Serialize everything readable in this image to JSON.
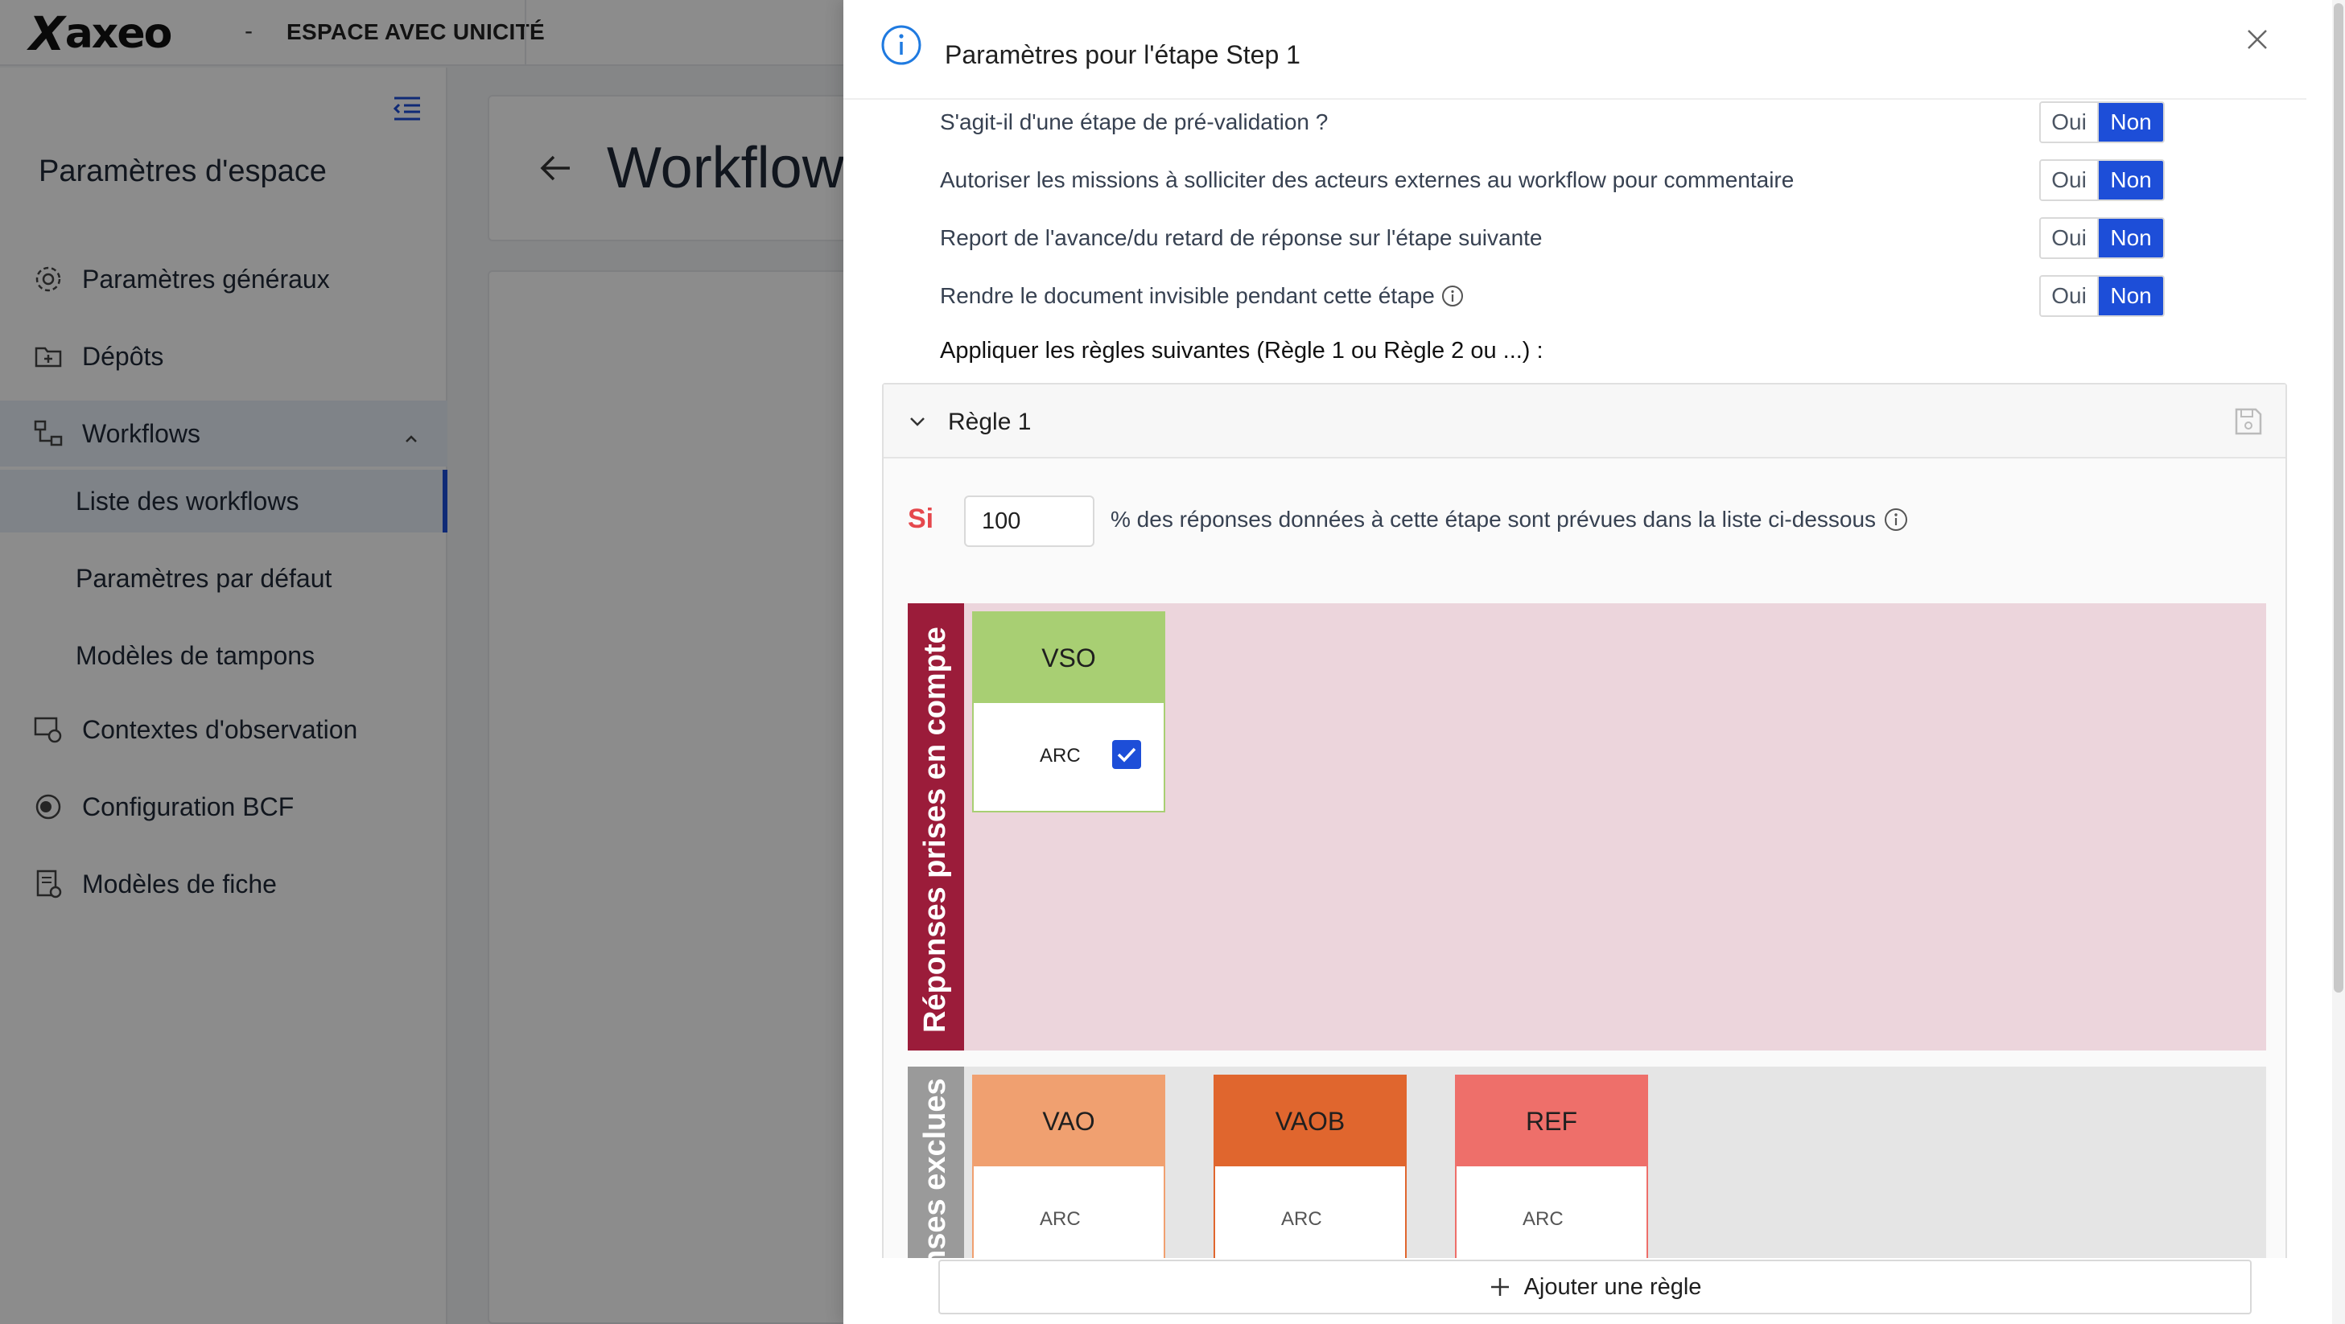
{
  "app": {
    "logo_text": "axeo",
    "logo_x": "X",
    "logo_dash": "-",
    "workspace": "ESPACE AVEC UNICITÉ"
  },
  "sidebar": {
    "title": "Paramètres d'espace",
    "items": [
      {
        "label": "Paramètres généraux",
        "icon": "gear-icon"
      },
      {
        "label": "Dépôts",
        "icon": "folder-icon"
      },
      {
        "label": "Workflows",
        "icon": "workflow-icon"
      },
      {
        "label": "Contextes d'observation",
        "icon": "observation-icon"
      },
      {
        "label": "Configuration BCF",
        "icon": "bcf-icon"
      },
      {
        "label": "Modèles de fiche",
        "icon": "form-icon"
      }
    ],
    "workflow_subitems": [
      {
        "label": "Liste des workflows",
        "active": true
      },
      {
        "label": "Paramètres par défaut",
        "active": false
      },
      {
        "label": "Modèles de tampons",
        "active": false
      }
    ]
  },
  "main": {
    "page_title": "Workflows"
  },
  "drawer": {
    "title": "Paramètres pour l'étape Step 1",
    "questions": [
      {
        "label": "S'agit-il d'une étape de pré-validation ?",
        "yes": "Oui",
        "no": "Non",
        "selected": "Non"
      },
      {
        "label": "Autoriser les missions à solliciter des acteurs externes au workflow pour commentaire",
        "yes": "Oui",
        "no": "Non",
        "selected": "Non"
      },
      {
        "label": "Report de l'avance/du retard de réponse sur l'étape suivante",
        "yes": "Oui",
        "no": "Non",
        "selected": "Non"
      },
      {
        "label": "Rendre le document invisible pendant cette étape",
        "yes": "Oui",
        "no": "Non",
        "selected": "Non"
      }
    ],
    "rules_intro": "Appliquer les règles suivantes (Règle 1 ou Règle 2 ou ...) :",
    "rule": {
      "title": "Règle 1",
      "if_label": "Si",
      "percent": "100",
      "percent_text": "% des réponses données à cette étape sont prévues dans la liste ci-dessous",
      "included_label": "Réponses prises en compte",
      "excluded_label": "Réponses exclues",
      "included": [
        {
          "code": "VSO",
          "sub": "ARC",
          "checked": true,
          "color": "#a8cf73",
          "border": "#a8cf73"
        }
      ],
      "excluded": [
        {
          "code": "VAO",
          "sub": "ARC",
          "checked": false,
          "color": "#f0a070",
          "border": "#f0a070"
        },
        {
          "code": "VAOB",
          "sub": "ARC",
          "checked": false,
          "color": "#e0662e",
          "border": "#e0662e"
        },
        {
          "code": "REF",
          "sub": "ARC",
          "checked": false,
          "color": "#ee6f6a",
          "border": "#ee6f6a"
        }
      ]
    },
    "add_rule": "Ajouter une règle"
  },
  "colors": {
    "primary": "#1d4ed8",
    "included_zone": "#ecd5dc",
    "included_bar": "#9b1c3a",
    "excluded_zone": "#e5e5e5",
    "excluded_bar": "#9a9a9a",
    "si_label": "#e5484d"
  }
}
